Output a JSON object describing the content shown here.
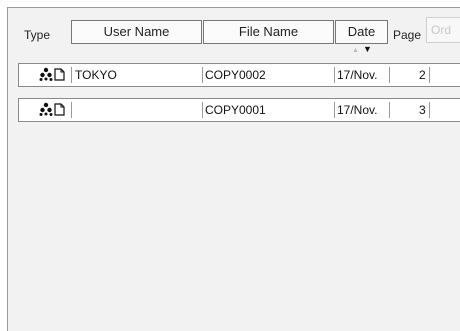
{
  "header": {
    "type_label": "Type",
    "user_name_label": "User Name",
    "file_name_label": "File Name",
    "date_label": "Date",
    "page_label": "Page",
    "order_label": "Ord"
  },
  "rows": [
    {
      "user": "TOKYO",
      "file": "COPY0002",
      "date": "17/Nov.",
      "pages": "2"
    },
    {
      "user": "",
      "file": "COPY0001",
      "date": "17/Nov.",
      "pages": "3"
    }
  ]
}
